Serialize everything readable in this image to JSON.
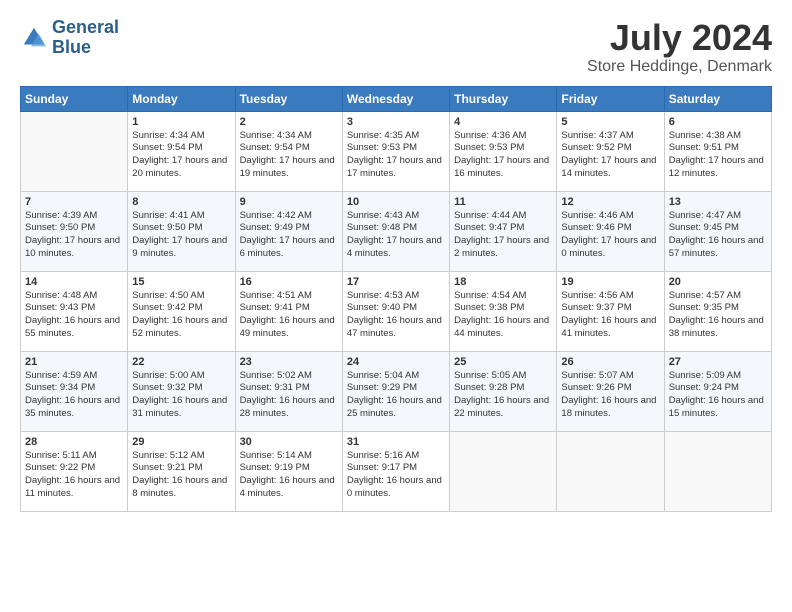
{
  "logo": {
    "line1": "General",
    "line2": "Blue"
  },
  "title": "July 2024",
  "location": "Store Heddinge, Denmark",
  "days_header": [
    "Sunday",
    "Monday",
    "Tuesday",
    "Wednesday",
    "Thursday",
    "Friday",
    "Saturday"
  ],
  "weeks": [
    [
      {
        "num": "",
        "sunrise": "",
        "sunset": "",
        "daylight": "",
        "empty": true
      },
      {
        "num": "1",
        "sunrise": "Sunrise: 4:34 AM",
        "sunset": "Sunset: 9:54 PM",
        "daylight": "Daylight: 17 hours and 20 minutes."
      },
      {
        "num": "2",
        "sunrise": "Sunrise: 4:34 AM",
        "sunset": "Sunset: 9:54 PM",
        "daylight": "Daylight: 17 hours and 19 minutes."
      },
      {
        "num": "3",
        "sunrise": "Sunrise: 4:35 AM",
        "sunset": "Sunset: 9:53 PM",
        "daylight": "Daylight: 17 hours and 17 minutes."
      },
      {
        "num": "4",
        "sunrise": "Sunrise: 4:36 AM",
        "sunset": "Sunset: 9:53 PM",
        "daylight": "Daylight: 17 hours and 16 minutes."
      },
      {
        "num": "5",
        "sunrise": "Sunrise: 4:37 AM",
        "sunset": "Sunset: 9:52 PM",
        "daylight": "Daylight: 17 hours and 14 minutes."
      },
      {
        "num": "6",
        "sunrise": "Sunrise: 4:38 AM",
        "sunset": "Sunset: 9:51 PM",
        "daylight": "Daylight: 17 hours and 12 minutes."
      }
    ],
    [
      {
        "num": "7",
        "sunrise": "Sunrise: 4:39 AM",
        "sunset": "Sunset: 9:50 PM",
        "daylight": "Daylight: 17 hours and 10 minutes."
      },
      {
        "num": "8",
        "sunrise": "Sunrise: 4:41 AM",
        "sunset": "Sunset: 9:50 PM",
        "daylight": "Daylight: 17 hours and 9 minutes."
      },
      {
        "num": "9",
        "sunrise": "Sunrise: 4:42 AM",
        "sunset": "Sunset: 9:49 PM",
        "daylight": "Daylight: 17 hours and 6 minutes."
      },
      {
        "num": "10",
        "sunrise": "Sunrise: 4:43 AM",
        "sunset": "Sunset: 9:48 PM",
        "daylight": "Daylight: 17 hours and 4 minutes."
      },
      {
        "num": "11",
        "sunrise": "Sunrise: 4:44 AM",
        "sunset": "Sunset: 9:47 PM",
        "daylight": "Daylight: 17 hours and 2 minutes."
      },
      {
        "num": "12",
        "sunrise": "Sunrise: 4:46 AM",
        "sunset": "Sunset: 9:46 PM",
        "daylight": "Daylight: 17 hours and 0 minutes."
      },
      {
        "num": "13",
        "sunrise": "Sunrise: 4:47 AM",
        "sunset": "Sunset: 9:45 PM",
        "daylight": "Daylight: 16 hours and 57 minutes."
      }
    ],
    [
      {
        "num": "14",
        "sunrise": "Sunrise: 4:48 AM",
        "sunset": "Sunset: 9:43 PM",
        "daylight": "Daylight: 16 hours and 55 minutes."
      },
      {
        "num": "15",
        "sunrise": "Sunrise: 4:50 AM",
        "sunset": "Sunset: 9:42 PM",
        "daylight": "Daylight: 16 hours and 52 minutes."
      },
      {
        "num": "16",
        "sunrise": "Sunrise: 4:51 AM",
        "sunset": "Sunset: 9:41 PM",
        "daylight": "Daylight: 16 hours and 49 minutes."
      },
      {
        "num": "17",
        "sunrise": "Sunrise: 4:53 AM",
        "sunset": "Sunset: 9:40 PM",
        "daylight": "Daylight: 16 hours and 47 minutes."
      },
      {
        "num": "18",
        "sunrise": "Sunrise: 4:54 AM",
        "sunset": "Sunset: 9:38 PM",
        "daylight": "Daylight: 16 hours and 44 minutes."
      },
      {
        "num": "19",
        "sunrise": "Sunrise: 4:56 AM",
        "sunset": "Sunset: 9:37 PM",
        "daylight": "Daylight: 16 hours and 41 minutes."
      },
      {
        "num": "20",
        "sunrise": "Sunrise: 4:57 AM",
        "sunset": "Sunset: 9:35 PM",
        "daylight": "Daylight: 16 hours and 38 minutes."
      }
    ],
    [
      {
        "num": "21",
        "sunrise": "Sunrise: 4:59 AM",
        "sunset": "Sunset: 9:34 PM",
        "daylight": "Daylight: 16 hours and 35 minutes."
      },
      {
        "num": "22",
        "sunrise": "Sunrise: 5:00 AM",
        "sunset": "Sunset: 9:32 PM",
        "daylight": "Daylight: 16 hours and 31 minutes."
      },
      {
        "num": "23",
        "sunrise": "Sunrise: 5:02 AM",
        "sunset": "Sunset: 9:31 PM",
        "daylight": "Daylight: 16 hours and 28 minutes."
      },
      {
        "num": "24",
        "sunrise": "Sunrise: 5:04 AM",
        "sunset": "Sunset: 9:29 PM",
        "daylight": "Daylight: 16 hours and 25 minutes."
      },
      {
        "num": "25",
        "sunrise": "Sunrise: 5:05 AM",
        "sunset": "Sunset: 9:28 PM",
        "daylight": "Daylight: 16 hours and 22 minutes."
      },
      {
        "num": "26",
        "sunrise": "Sunrise: 5:07 AM",
        "sunset": "Sunset: 9:26 PM",
        "daylight": "Daylight: 16 hours and 18 minutes."
      },
      {
        "num": "27",
        "sunrise": "Sunrise: 5:09 AM",
        "sunset": "Sunset: 9:24 PM",
        "daylight": "Daylight: 16 hours and 15 minutes."
      }
    ],
    [
      {
        "num": "28",
        "sunrise": "Sunrise: 5:11 AM",
        "sunset": "Sunset: 9:22 PM",
        "daylight": "Daylight: 16 hours and 11 minutes."
      },
      {
        "num": "29",
        "sunrise": "Sunrise: 5:12 AM",
        "sunset": "Sunset: 9:21 PM",
        "daylight": "Daylight: 16 hours and 8 minutes."
      },
      {
        "num": "30",
        "sunrise": "Sunrise: 5:14 AM",
        "sunset": "Sunset: 9:19 PM",
        "daylight": "Daylight: 16 hours and 4 minutes."
      },
      {
        "num": "31",
        "sunrise": "Sunrise: 5:16 AM",
        "sunset": "Sunset: 9:17 PM",
        "daylight": "Daylight: 16 hours and 0 minutes."
      },
      {
        "num": "",
        "sunrise": "",
        "sunset": "",
        "daylight": "",
        "empty": true
      },
      {
        "num": "",
        "sunrise": "",
        "sunset": "",
        "daylight": "",
        "empty": true
      },
      {
        "num": "",
        "sunrise": "",
        "sunset": "",
        "daylight": "",
        "empty": true
      }
    ]
  ]
}
